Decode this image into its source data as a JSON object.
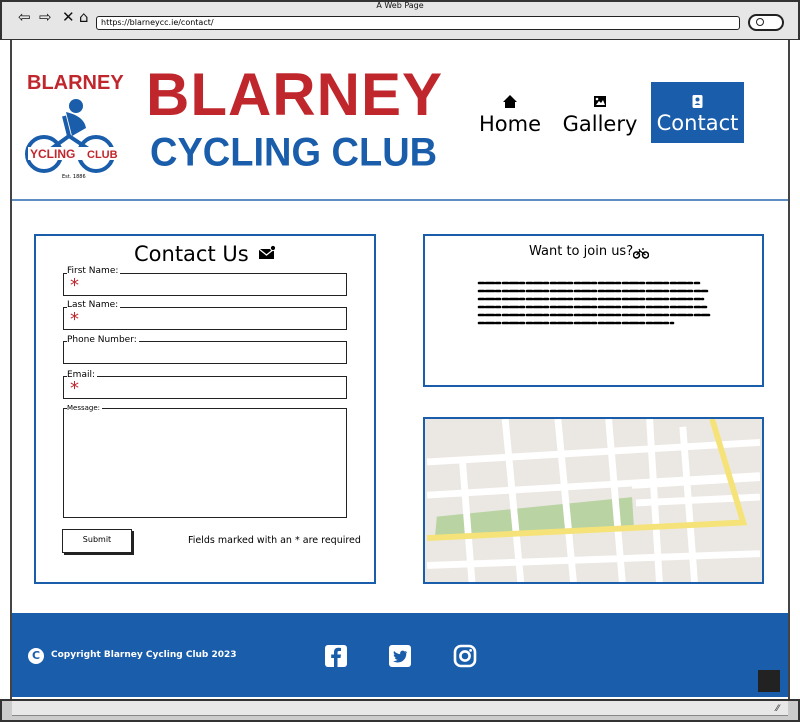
{
  "window": {
    "title": "A Web Page",
    "url": "https://blarneycc.ie/contact/"
  },
  "logo": {
    "wordmark": "BLARNEY",
    "bike_text": "YCLING CLUB",
    "est": "Est. 1886"
  },
  "brand": {
    "line1": "BLARNEY",
    "line2": "CYCLING CLUB",
    "colors": {
      "red": "#c0272d",
      "blue": "#1a5dab"
    }
  },
  "nav": {
    "items": [
      {
        "label": "Home",
        "icon": "home-icon"
      },
      {
        "label": "Gallery",
        "icon": "image-icon"
      },
      {
        "label": "Contact",
        "icon": "contact-book-icon",
        "active": true
      }
    ]
  },
  "contact_form": {
    "title": "Contact Us",
    "fields": {
      "first_name": {
        "label": "First Name:",
        "required_mark": "*"
      },
      "last_name": {
        "label": "Last Name:",
        "required_mark": "*"
      },
      "phone": {
        "label": "Phone Number:"
      },
      "email": {
        "label": "Email:",
        "required_mark": "*"
      },
      "message": {
        "label": "Message:"
      }
    },
    "submit_label": "Submit",
    "required_note": "Fields marked with an * are required"
  },
  "join": {
    "title": "Want to join us?"
  },
  "footer": {
    "copyright": "Copyright Blarney Cycling Club 2023",
    "social": [
      "facebook-icon",
      "twitter-icon",
      "instagram-icon"
    ]
  }
}
